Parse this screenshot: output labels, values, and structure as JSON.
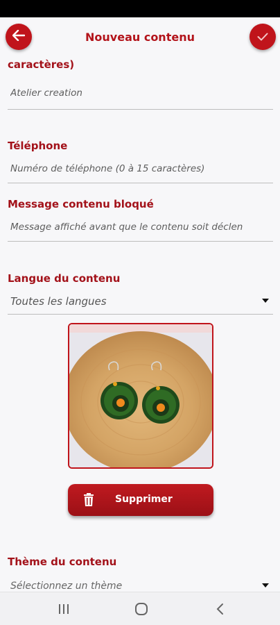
{
  "header": {
    "title": "Nouveau contenu",
    "back_icon": "arrow-left-icon",
    "confirm_icon": "checkmark-icon",
    "accent_color": "#c0141b"
  },
  "form": {
    "partial_label": "caractères)",
    "name_value": "Atelier creation",
    "phone": {
      "label": "Téléphone",
      "placeholder": "Numéro de téléphone (0 à 15 caractères)"
    },
    "blocked_message": {
      "label": "Message contenu bloqué",
      "placeholder": "Message affiché avant que le contenu soit déclen"
    },
    "language": {
      "label": "Langue du contenu",
      "selected": "Toutes les langues"
    },
    "image": {
      "subject": "green and orange hoop earrings on a wood slice"
    },
    "delete_button": {
      "label": "Supprimer",
      "icon": "trash-icon"
    },
    "theme": {
      "label": "Thème du contenu",
      "placeholder": "Sélectionnez un thème"
    }
  },
  "nav": {
    "recent_icon": "recent-apps-icon",
    "home_icon": "home-icon",
    "back_icon": "back-icon"
  }
}
